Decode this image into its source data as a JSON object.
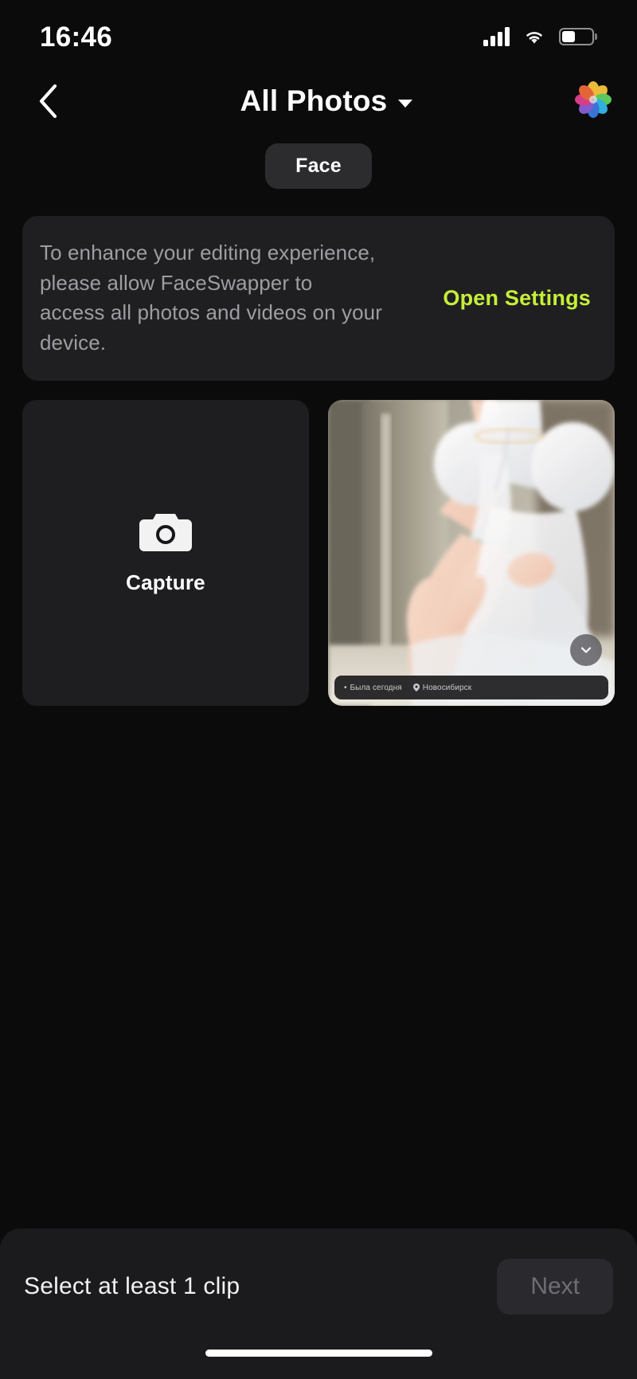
{
  "status_bar": {
    "time": "16:46",
    "cellular_icon": "cellular-bars-icon",
    "wifi_icon": "wifi-icon",
    "battery_icon": "battery-icon"
  },
  "nav": {
    "back_icon": "chevron-left-icon",
    "title": "All Photos",
    "dropdown_icon": "chevron-down-icon",
    "photos_app_icon": "photos-flower-icon"
  },
  "filter_tabs": {
    "selected": "Face"
  },
  "permission_banner": {
    "message": "To enhance your editing experience, please allow FaceSwapper to access all photos and videos on your device.",
    "action_label": "Open Settings",
    "action_color": "#c6ef3a"
  },
  "gallery": {
    "capture_tile": {
      "label": "Capture",
      "icon": "camera-icon"
    },
    "items": [
      {
        "type": "photo",
        "expand_icon": "chevron-down-circle-icon",
        "overlay": {
          "status_text": "Была сегодня",
          "status_prefix": "•",
          "location_text": "Новосибирск",
          "location_icon": "pin-icon"
        }
      }
    ]
  },
  "bottom_bar": {
    "hint": "Select at least 1 clip",
    "next_label": "Next",
    "next_enabled": false
  },
  "home_indicator": "home-indicator"
}
